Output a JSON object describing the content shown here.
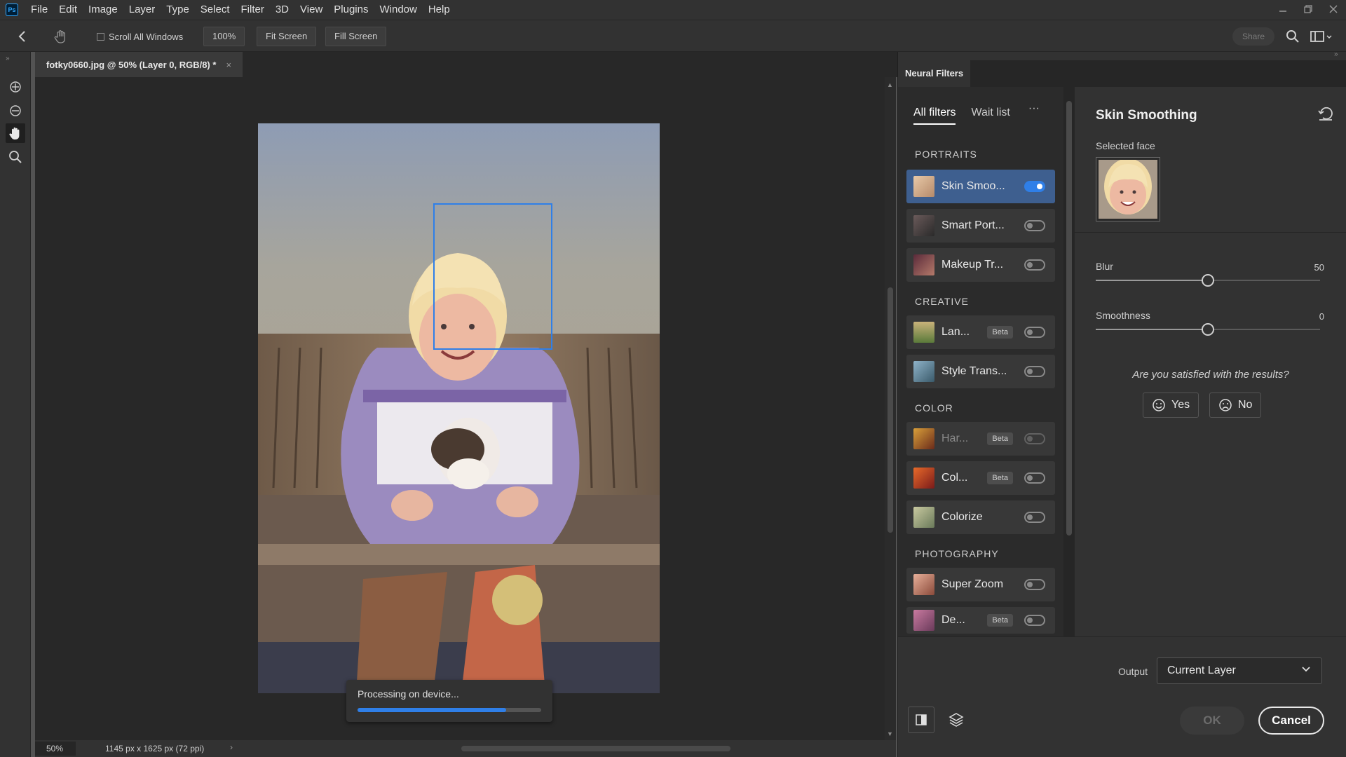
{
  "app": {
    "logo": "Ps",
    "menus": [
      "File",
      "Edit",
      "Image",
      "Layer",
      "Type",
      "Select",
      "Filter",
      "3D",
      "View",
      "Plugins",
      "Window",
      "Help"
    ]
  },
  "options_bar": {
    "scroll_all_windows": "Scroll All Windows",
    "zoom_100": "100%",
    "fit_screen": "Fit Screen",
    "fill_screen": "Fill Screen",
    "share": "Share"
  },
  "document": {
    "tab_title": "fotky0660.jpg @ 50% (Layer 0, RGB/8) *",
    "close_glyph": "×"
  },
  "processing": {
    "label": "Processing on device...",
    "progress": 0.81
  },
  "status": {
    "zoom": "50%",
    "info": "1145 px x 1625 px (72 ppi)",
    "arrow": "›"
  },
  "neural_filters": {
    "panel_title": "Neural Filters",
    "tabs": [
      "All filters",
      "Wait list"
    ],
    "more": "···",
    "categories": {
      "portraits": "PORTRAITS",
      "creative": "CREATIVE",
      "color": "COLOR",
      "photography": "PHOTOGRAPHY"
    },
    "filters": [
      {
        "name": "Skin Smoo...",
        "on": true,
        "beta": false
      },
      {
        "name": "Smart Port...",
        "on": false,
        "beta": false
      },
      {
        "name": "Makeup Tr...",
        "on": false,
        "beta": false
      },
      {
        "name": "Lan...",
        "on": false,
        "beta": true
      },
      {
        "name": "Style Trans...",
        "on": false,
        "beta": false
      },
      {
        "name": "Har...",
        "on": false,
        "beta": true
      },
      {
        "name": "Col...",
        "on": false,
        "beta": true
      },
      {
        "name": "Colorize",
        "on": false,
        "beta": false
      },
      {
        "name": "Super Zoom",
        "on": false,
        "beta": false
      },
      {
        "name": "De...",
        "on": false,
        "beta": true
      }
    ],
    "beta_label": "Beta",
    "settings": {
      "title": "Skin Smoothing",
      "selected_face": "Selected face",
      "blur_label": "Blur",
      "blur_value": "50",
      "blur_fraction": 0.5,
      "smoothness_label": "Smoothness",
      "smoothness_value": "0",
      "smoothness_fraction": 0.5,
      "question": "Are you satisfied with the results?",
      "yes": "Yes",
      "no": "No"
    },
    "output_label": "Output",
    "output_value": "Current Layer",
    "ok": "OK",
    "cancel": "Cancel"
  },
  "colors": {
    "accent": "#2f7fe8",
    "panel_bg": "#323232",
    "canvas_bg": "#282828"
  }
}
